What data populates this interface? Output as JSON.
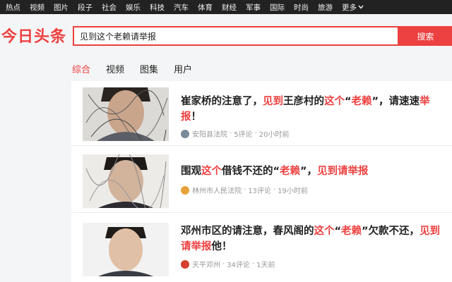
{
  "topnav": {
    "items": [
      "热点",
      "视频",
      "图片",
      "段子",
      "社会",
      "娱乐",
      "科技",
      "汽车",
      "体育",
      "财经",
      "军事",
      "国际",
      "时尚",
      "旅游"
    ],
    "more_label": "更多"
  },
  "header": {
    "logo": "今日头条",
    "search_value": "见到这个老赖请举报",
    "search_button": "搜索"
  },
  "tabs": [
    "综合",
    "视频",
    "图集",
    "用户"
  ],
  "results": [
    {
      "title_parts": [
        {
          "text": "崔家桥的注意了，",
          "hl": false
        },
        {
          "text": "见到",
          "hl": true
        },
        {
          "text": "王彦村的",
          "hl": false
        },
        {
          "text": "这个",
          "hl": true
        },
        {
          "text": "“",
          "hl": false
        },
        {
          "text": "老赖",
          "hl": true
        },
        {
          "text": "”，请速速",
          "hl": false
        },
        {
          "text": "举报",
          "hl": true
        },
        {
          "text": "！",
          "hl": false
        }
      ],
      "source": "安阳县法院",
      "comments": "5评论",
      "time": "20小时前"
    },
    {
      "title_parts": [
        {
          "text": "围观",
          "hl": false
        },
        {
          "text": "这个",
          "hl": true
        },
        {
          "text": "借钱不还的“",
          "hl": false
        },
        {
          "text": "老赖",
          "hl": true
        },
        {
          "text": "”，",
          "hl": false
        },
        {
          "text": "见到请举报",
          "hl": true
        }
      ],
      "source": "林州市人民法院",
      "comments": "13评论",
      "time": "19小时前"
    },
    {
      "title_parts": [
        {
          "text": "邓州市区的请注意，春风阁的",
          "hl": false
        },
        {
          "text": "这个",
          "hl": true
        },
        {
          "text": "“",
          "hl": false
        },
        {
          "text": "老赖",
          "hl": true
        },
        {
          "text": "”欠款不还，",
          "hl": false
        },
        {
          "text": "见到请举报",
          "hl": true
        },
        {
          "text": "他！",
          "hl": false
        }
      ],
      "source": "天平邓州",
      "comments": "34评论",
      "time": "1天前"
    }
  ],
  "colors": {
    "brand": "#ed4040",
    "nav_bg": "#222222",
    "page_bg": "#f4f5f6"
  }
}
